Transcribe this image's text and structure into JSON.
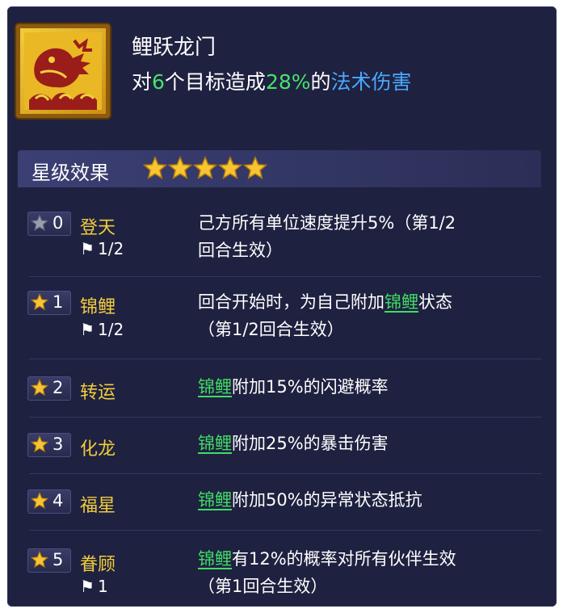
{
  "skill": {
    "name": "鲤跃龙门",
    "desc_prefix": "对",
    "desc_targets": "6",
    "desc_middle": "个目标造成",
    "desc_percent": "28%",
    "desc_of": "的",
    "desc_type": "法术伤害",
    "icon": "carp-dragon-icon"
  },
  "colors": {
    "green": "#45e26b",
    "blue": "#49a9ff",
    "gold": "#f0cd3c",
    "panel": "#1f2140"
  },
  "stars_section": {
    "title": "星级效果",
    "star_count": 5
  },
  "rows": [
    {
      "level": "0",
      "name": "登天",
      "count": "1/2",
      "desc_link": "",
      "desc_line1": "己方所有单位速度提升5%（第1/2",
      "desc_line2": "回合生效）",
      "star_active": false
    },
    {
      "level": "1",
      "name": "锦鲤",
      "count": "1/2",
      "desc_pre": "回合开始时，为自己附加",
      "desc_link": "锦鲤",
      "desc_post": "状态",
      "desc_line2": "（第1/2回合生效）",
      "star_active": true
    },
    {
      "level": "2",
      "name": "转运",
      "desc_link": "锦鲤",
      "desc_line1": "附加15%的闪避概率",
      "star_active": true
    },
    {
      "level": "3",
      "name": "化龙",
      "desc_link": "锦鲤",
      "desc_line1": "附加25%的暴击伤害",
      "star_active": true
    },
    {
      "level": "4",
      "name": "福星",
      "desc_link": "锦鲤",
      "desc_line1": "附加50%的异常状态抵抗",
      "star_active": true
    },
    {
      "level": "5",
      "name": "眷顾",
      "count": "1",
      "desc_link": "锦鲤",
      "desc_line1": "有12%的概率对所有伙伴生效",
      "desc_line2": "（第1回合生效）",
      "star_active": true
    }
  ]
}
